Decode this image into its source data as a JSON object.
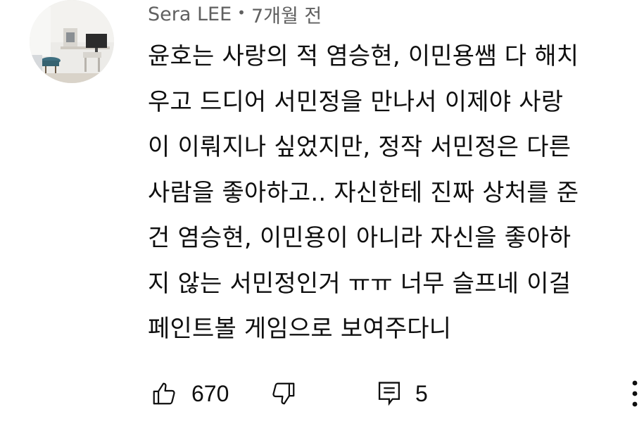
{
  "comment": {
    "author": "Sera LEE",
    "separator": "•",
    "time": "7개월 전",
    "lines": [
      "윤호는 사랑의 적 염승현, 이민용쌤 다 해치",
      "우고 드디어 서민정을 만나서 이제야 사랑",
      "이 이뤄지나 싶었지만, 정작 서민정은 다른",
      "사람을 좋아하고.. 자신한테 진짜 상처를 준",
      "건 염승현, 이민용이 아니라 자신을 좋아하",
      "지 않는 서민정인거 ㅠㅠ 너무 슬프네 이걸",
      "페인트볼 게임으로 보여주다니"
    ]
  },
  "actions": {
    "like_count": "670",
    "reply_count": "5"
  },
  "icons": {
    "like": "thumbs-up-icon",
    "dislike": "thumbs-down-icon",
    "reply": "comment-icon",
    "more": "more-vertical-icon"
  },
  "colors": {
    "text": "#0f0f0f",
    "meta": "#606060",
    "background": "#ffffff"
  }
}
